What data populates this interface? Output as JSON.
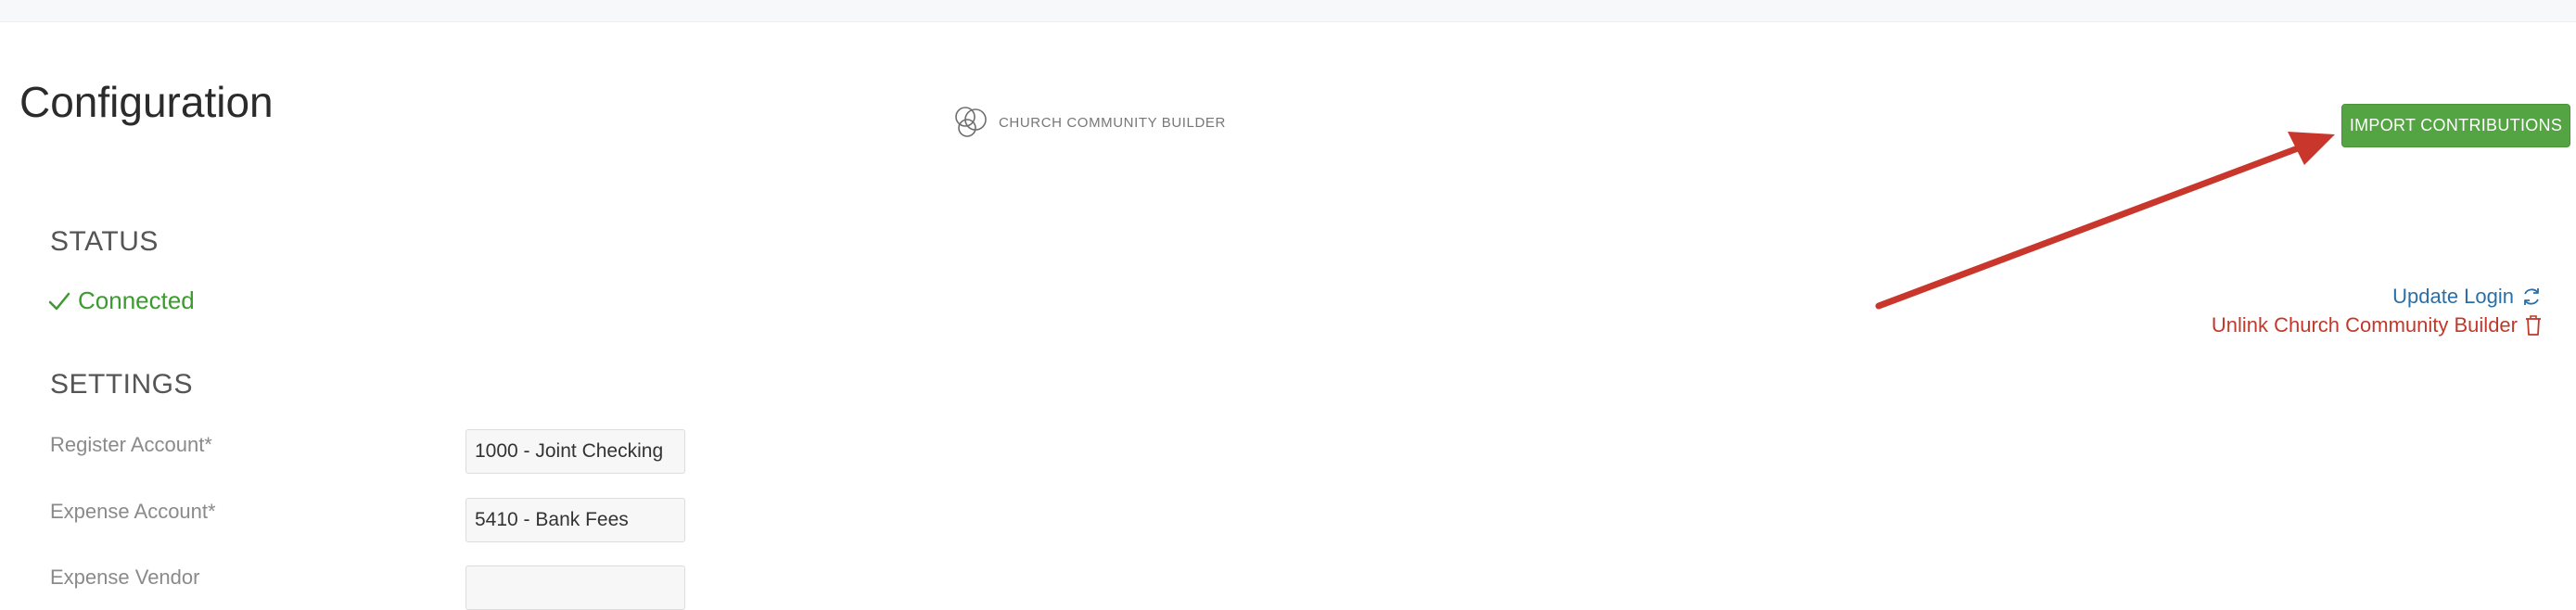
{
  "page": {
    "title": "Configuration"
  },
  "integration": {
    "name": "CHURCH COMMUNITY BUILDER"
  },
  "actions": {
    "import_label": "IMPORT CONTRIBUTIONS",
    "update_login": "Update Login",
    "unlink": "Unlink Church Community Builder"
  },
  "status": {
    "heading": "STATUS",
    "value": "Connected"
  },
  "settings": {
    "heading": "SETTINGS",
    "fields": [
      {
        "label": "Register Account*",
        "value": "1000 - Joint Checking"
      },
      {
        "label": "Expense Account*",
        "value": "5410 - Bank Fees"
      },
      {
        "label": "Expense Vendor",
        "value": ""
      }
    ]
  },
  "colors": {
    "primary_button": "#55a443",
    "connected": "#3c9a2f",
    "link": "#2c6fa6",
    "danger": "#c0392b",
    "annotation_arrow": "#c9372c"
  },
  "icons": {
    "logo": "interlocking-circles-logo",
    "status": "check-icon",
    "update": "refresh-icon",
    "unlink": "trash-icon"
  }
}
